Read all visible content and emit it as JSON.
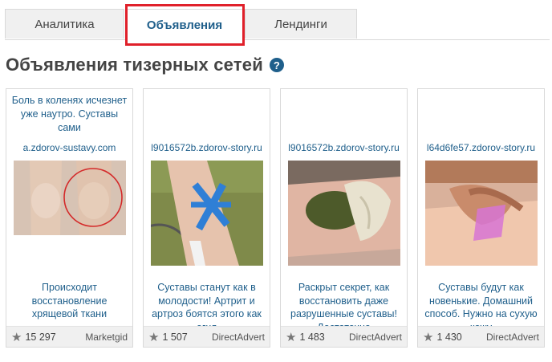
{
  "tabs": [
    {
      "label": "Аналитика"
    },
    {
      "label": "Объявления"
    },
    {
      "label": "Лендинги"
    }
  ],
  "title": "Объявления тизерных сетей",
  "help_icon": "?",
  "cards": [
    {
      "top": "Боль в коленях исчезнет уже наутро. Суставы сами",
      "domain": "a.zdorov-sustavy.com",
      "bottom": "Происходит восстановление хрящевой ткани",
      "views": "15 297",
      "network": "Marketgid"
    },
    {
      "top": "",
      "domain": "l9016572b.zdorov-story.ru",
      "bottom": "Суставы станут как в молодости! Артрит и артроз боятся этого как огня",
      "views": "1 507",
      "network": "DirectAdvert"
    },
    {
      "top": "",
      "domain": "l9016572b.zdorov-story.ru",
      "bottom": "Раскрыт секрет, как восстановить даже разрушенные суставы! Достаточно",
      "views": "1 483",
      "network": "DirectAdvert"
    },
    {
      "top": "",
      "domain": "l64d6fe57.zdorov-story.ru",
      "bottom": "Суставы будут как новенькие. Домашний способ. Нужно на сухую кожу",
      "views": "1 430",
      "network": "DirectAdvert"
    }
  ],
  "colors": {
    "accent": "#1f5f8b",
    "highlight": "#e0202a"
  }
}
